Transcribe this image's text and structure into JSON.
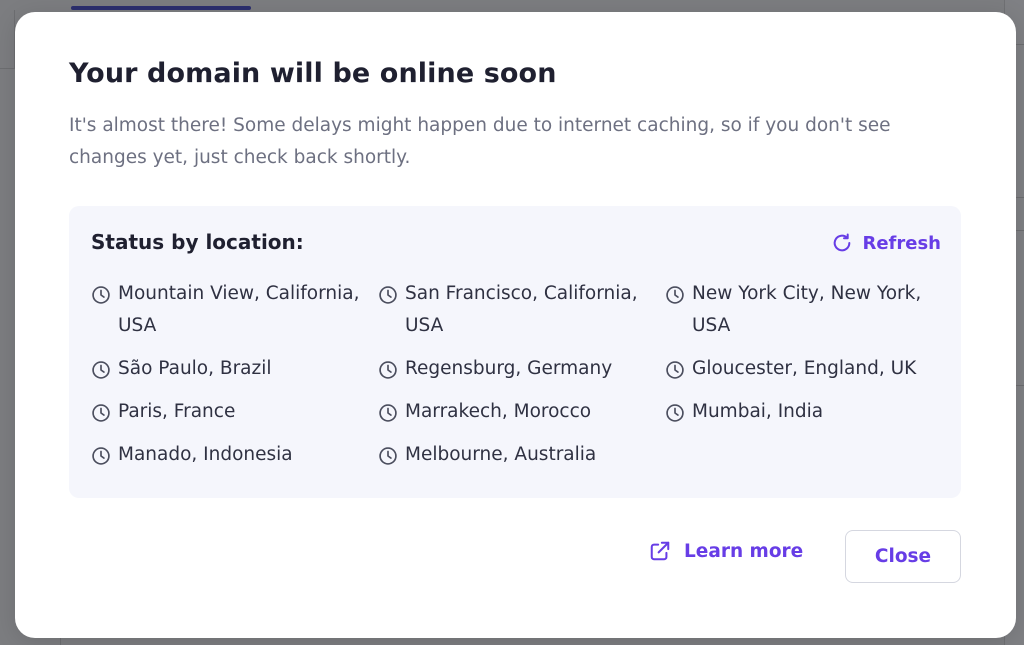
{
  "modal": {
    "title": "Your domain will be online soon",
    "description": "It's almost there! Some delays might happen due to internet caching, so if you don't see changes yet, just check back shortly."
  },
  "status": {
    "title": "Status by location:",
    "refresh_label": "Refresh",
    "refresh_icon": "refresh-icon",
    "location_icon": "clock-icon",
    "locations": [
      "Mountain View, California, USA",
      "San Francisco, California, USA",
      "New York City, New York, USA",
      "São Paulo, Brazil",
      "Regensburg, Germany",
      "Gloucester, England, UK",
      "Paris, France",
      "Marrakech, Morocco",
      "Mumbai, India",
      "Manado, Indonesia",
      "Melbourne, Australia"
    ]
  },
  "footer": {
    "learn_more_label": "Learn more",
    "learn_more_icon": "external-link-icon",
    "close_label": "Close"
  },
  "colors": {
    "accent": "#673de6",
    "overlay": "#7c7d80",
    "status_background": "#f5f6fc",
    "title_text": "#1f2030",
    "body_text": "#6d7081"
  }
}
